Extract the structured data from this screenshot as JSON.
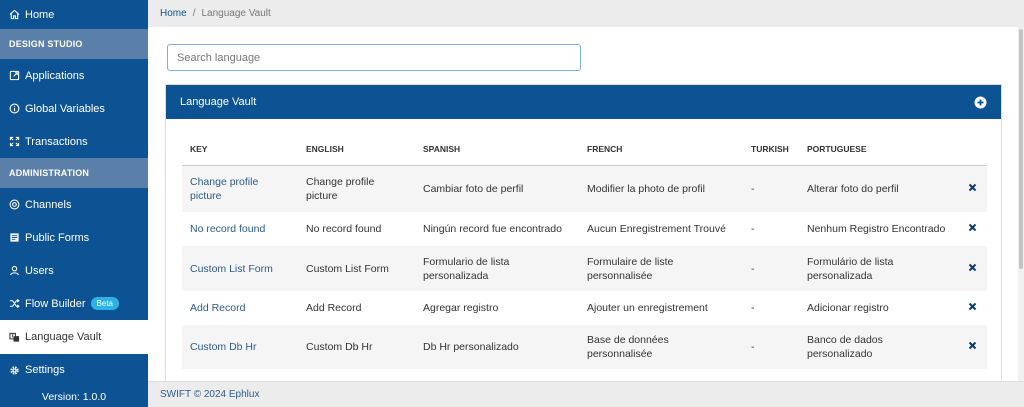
{
  "sidebar": {
    "home": "Home",
    "section_design": "DESIGN STUDIO",
    "applications": "Applications",
    "global_variables": "Global Variables",
    "transactions": "Transactions",
    "section_admin": "ADMINISTRATION",
    "channels": "Channels",
    "public_forms": "Public Forms",
    "users": "Users",
    "flow_builder": "Flow Builder",
    "beta": "Beta",
    "language_vault": "Language Vault",
    "settings": "Settings",
    "version": "Version: 1.0.0"
  },
  "breadcrumb": {
    "home": "Home",
    "separator": "/",
    "current": "Language Vault"
  },
  "search": {
    "placeholder": "Search language",
    "value": ""
  },
  "card": {
    "title": "Language Vault"
  },
  "table": {
    "headers": [
      "KEY",
      "ENGLISH",
      "SPANISH",
      "FRENCH",
      "TURKISH",
      "PORTUGUESE"
    ],
    "rows": [
      {
        "key": "Change profile picture",
        "english": "Change profile picture",
        "spanish": "Cambiar foto de perfil",
        "french": "Modifier la photo de profil",
        "turkish": "-",
        "portuguese": "Alterar foto do perfil"
      },
      {
        "key": "No record found",
        "english": "No record found",
        "spanish": "Ningún record fue encontrado",
        "french": "Aucun Enregistrement Trouvé",
        "turkish": "-",
        "portuguese": "Nenhum Registro Encontrado"
      },
      {
        "key": "Custom List Form",
        "english": "Custom List Form",
        "spanish": "Formulario de lista personalizada",
        "french": "Formulaire de liste personnalisée",
        "turkish": "-",
        "portuguese": "Formulário de lista personalizada"
      },
      {
        "key": "Add Record",
        "english": "Add Record",
        "spanish": "Agregar registro",
        "french": "Ajouter un enregistrement",
        "turkish": "-",
        "portuguese": "Adicionar registro"
      },
      {
        "key": "Custom Db Hr",
        "english": "Custom Db Hr",
        "spanish": "Db Hr personalizado",
        "french": "Base de données personnalisée",
        "turkish": "-",
        "portuguese": "Banco de dados personalizado"
      }
    ]
  },
  "footer": {
    "text": "SWIFT © 2024 Ephlux"
  },
  "colors": {
    "primary": "#0d5394",
    "section": "#5a7fa8",
    "badge": "#2bb3e8",
    "link": "#2b5b8c"
  }
}
